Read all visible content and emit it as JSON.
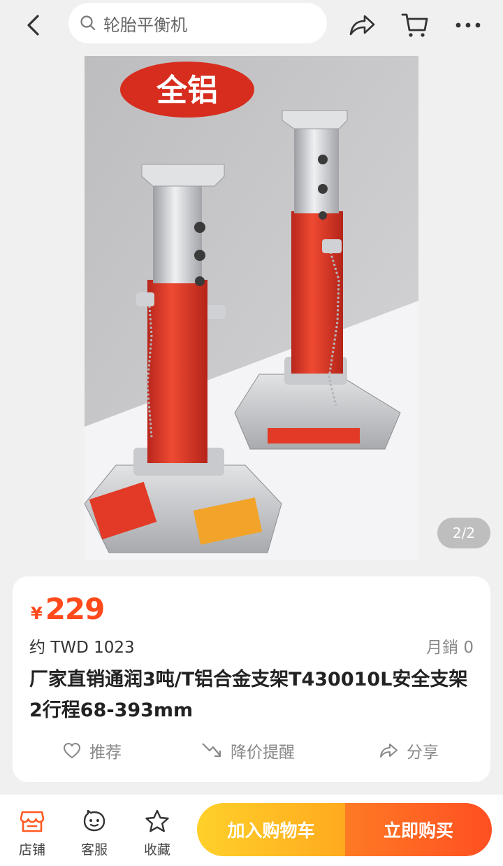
{
  "search": {
    "query": "轮胎平衡机"
  },
  "gallery": {
    "banner_text": "全铝",
    "counter": "2/2"
  },
  "product": {
    "currency_symbol": "¥",
    "price": "229",
    "converted_price": "约 TWD 1023",
    "monthly_sales": "月銷 0",
    "title": "厂家直销通润3吨/T铝合金支架T430010L安全支架2行程68-393mm"
  },
  "actions": {
    "recommend": "推荐",
    "price_drop": "降价提醒",
    "share": "分享"
  },
  "bottom": {
    "store": "店铺",
    "service": "客服",
    "favorite": "收藏",
    "add_to_cart": "加入购物车",
    "buy_now": "立即购买"
  },
  "colors": {
    "price": "#ff4a1c",
    "cart_button": "#ffbb22",
    "buy_button": "#ff5a22"
  },
  "icons": [
    "back-icon",
    "search-icon",
    "share-icon",
    "cart-icon",
    "more-icon",
    "heart-icon",
    "price-drop-icon",
    "store-icon",
    "service-icon",
    "star-icon"
  ]
}
